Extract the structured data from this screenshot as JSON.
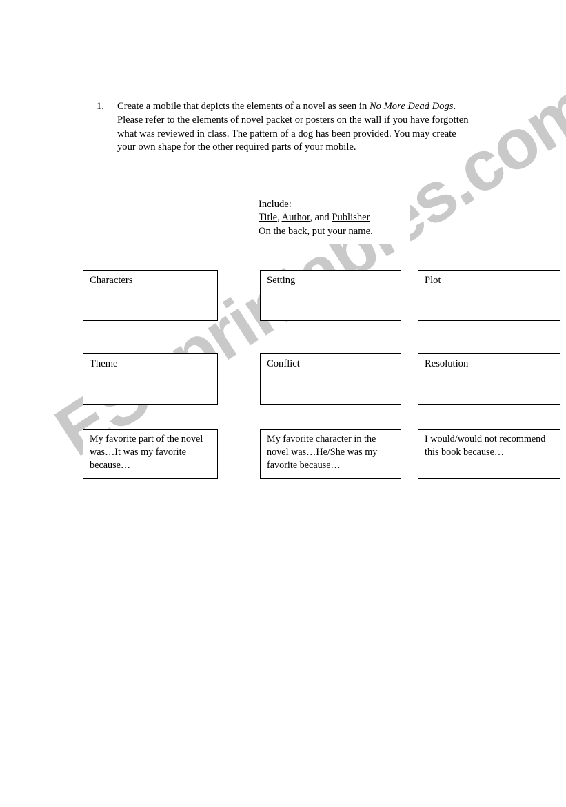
{
  "document": {
    "type": "worksheet",
    "watermark": "ESLprintables.com",
    "watermark_color": "#c9c9c9",
    "page_background": "#ffffff",
    "text_color": "#000000"
  },
  "instruction": {
    "number": "1.",
    "text_part_1": "Create a mobile that depicts the elements of a novel as seen in ",
    "book_title": "No More Dead Dogs",
    "text_part_2": ". Please refer to the elements of novel packet or posters on the wall if you have forgotten what was reviewed in class. The pattern of a dog has been provided.  You may create your own shape for the other required parts of your mobile."
  },
  "include_box": {
    "heading": "Include:",
    "line_2_item_1": "Title",
    "line_2_sep_1": ", ",
    "line_2_item_2": "Author",
    "line_2_sep_2": ", and ",
    "line_2_item_3": "Publisher",
    "line_3": "On the back, put your name."
  },
  "boxes": {
    "row_1": [
      {
        "label": "Characters"
      },
      {
        "label": "Setting"
      },
      {
        "label": "Plot"
      }
    ],
    "row_2": [
      {
        "label": "Theme"
      },
      {
        "label": "Conflict"
      },
      {
        "label": "Resolution"
      }
    ],
    "row_3": [
      {
        "label": "My favorite part of the novel was…It was my favorite because…"
      },
      {
        "label": "My favorite character in the novel was…He/She was my favorite because…"
      },
      {
        "label": "I would/would not recommend this book because…"
      }
    ]
  }
}
